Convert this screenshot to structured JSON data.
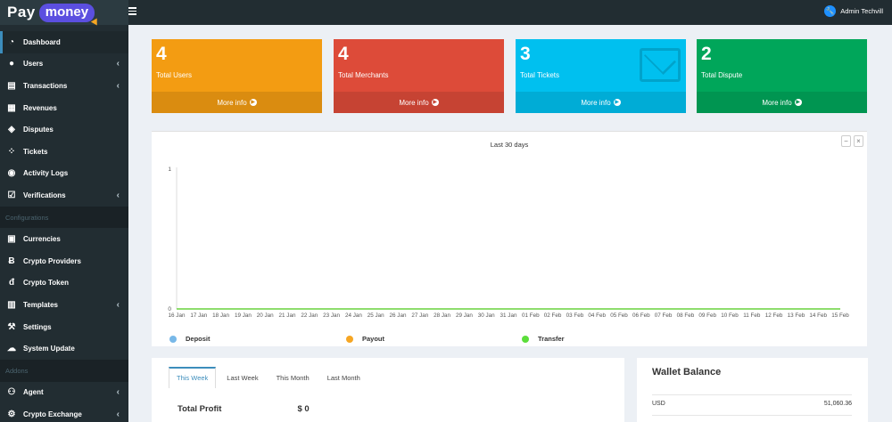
{
  "brand": {
    "pay": "Pay",
    "money": "money"
  },
  "header": {
    "user_name": "Admin Techvill"
  },
  "sidebar": {
    "items": [
      {
        "label": "Dashboard",
        "icon": "dashboard-icon",
        "active": true,
        "chevron": false
      },
      {
        "label": "Users",
        "icon": "user-icon",
        "chevron": true
      },
      {
        "label": "Transactions",
        "icon": "calendar-icon",
        "chevron": true
      },
      {
        "label": "Revenues",
        "icon": "chart-icon",
        "chevron": false
      },
      {
        "label": "Disputes",
        "icon": "ticket-icon",
        "chevron": false
      },
      {
        "label": "Tickets",
        "icon": "spinner-icon",
        "chevron": false
      },
      {
        "label": "Activity Logs",
        "icon": "eye-icon",
        "chevron": false
      },
      {
        "label": "Verifications",
        "icon": "checkbox-icon",
        "chevron": true
      }
    ],
    "config_header": "Configurations",
    "config_items": [
      {
        "label": "Currencies",
        "icon": "money-icon",
        "chevron": false
      },
      {
        "label": "Crypto Providers",
        "icon": "bitcoin-icon",
        "chevron": false
      },
      {
        "label": "Crypto Token",
        "icon": "token-icon",
        "chevron": false
      },
      {
        "label": "Templates",
        "icon": "template-icon",
        "chevron": true
      },
      {
        "label": "Settings",
        "icon": "wrench-icon",
        "chevron": false
      },
      {
        "label": "System Update",
        "icon": "cloud-upload-icon",
        "chevron": false
      }
    ],
    "addons_header": "Addons",
    "addon_items": [
      {
        "label": "Agent",
        "icon": "agent-icon",
        "chevron": true
      },
      {
        "label": "Crypto Exchange",
        "icon": "exchange-icon",
        "chevron": true
      }
    ]
  },
  "stats": [
    {
      "value": "4",
      "label": "Total Users",
      "more": "More info",
      "color": "#f39c12"
    },
    {
      "value": "4",
      "label": "Total Merchants",
      "more": "More info",
      "color": "#dd4b39"
    },
    {
      "value": "3",
      "label": "Total Tickets",
      "more": "More info",
      "color": "#00c0ef"
    },
    {
      "value": "2",
      "label": "Total Dispute",
      "more": "More info",
      "color": "#00a65a"
    }
  ],
  "chart_panel": {
    "minimize": "−",
    "close": "×"
  },
  "chart_data": {
    "type": "line",
    "title": "Last 30 days",
    "x": [
      "16 Jan",
      "17 Jan",
      "18 Jan",
      "19 Jan",
      "20 Jan",
      "21 Jan",
      "22 Jan",
      "23 Jan",
      "24 Jan",
      "25 Jan",
      "26 Jan",
      "27 Jan",
      "28 Jan",
      "29 Jan",
      "30 Jan",
      "31 Jan",
      "01 Feb",
      "02 Feb",
      "03 Feb",
      "04 Feb",
      "05 Feb",
      "06 Feb",
      "07 Feb",
      "08 Feb",
      "09 Feb",
      "10 Feb",
      "11 Feb",
      "12 Feb",
      "13 Feb",
      "14 Feb",
      "15 Feb"
    ],
    "yticks": [
      "0",
      "1"
    ],
    "ylim": [
      0,
      1
    ],
    "series": [
      {
        "name": "Deposit",
        "color": "#78b8e8",
        "values": [
          0,
          0,
          0,
          0,
          0,
          0,
          0,
          0,
          0,
          0,
          0,
          0,
          0,
          0,
          0,
          0,
          0,
          0,
          0,
          0,
          0,
          0,
          0,
          0,
          0,
          0,
          0,
          0,
          0,
          0,
          0
        ]
      },
      {
        "name": "Payout",
        "color": "#f6a623",
        "values": [
          0,
          0,
          0,
          0,
          0,
          0,
          0,
          0,
          0,
          0,
          0,
          0,
          0,
          0,
          0,
          0,
          0,
          0,
          0,
          0,
          0,
          0,
          0,
          0,
          0,
          0,
          0,
          0,
          0,
          0,
          0
        ]
      },
      {
        "name": "Transfer",
        "color": "#5cde3b",
        "values": [
          0,
          0,
          0,
          0,
          0,
          0,
          0,
          0,
          0,
          0,
          0,
          0,
          0,
          0,
          0,
          0,
          0,
          0,
          0,
          0,
          0,
          0,
          0,
          0,
          0,
          0,
          0,
          0,
          0,
          0,
          0
        ]
      }
    ]
  },
  "profit": {
    "tabs": [
      "This Week",
      "Last Week",
      "This Month",
      "Last Month"
    ],
    "active_tab": 0,
    "label": "Total Profit",
    "value": "$ 0"
  },
  "wallet": {
    "title": "Wallet Balance",
    "rows": [
      {
        "currency": "USD",
        "amount": "51,060.36"
      }
    ]
  }
}
